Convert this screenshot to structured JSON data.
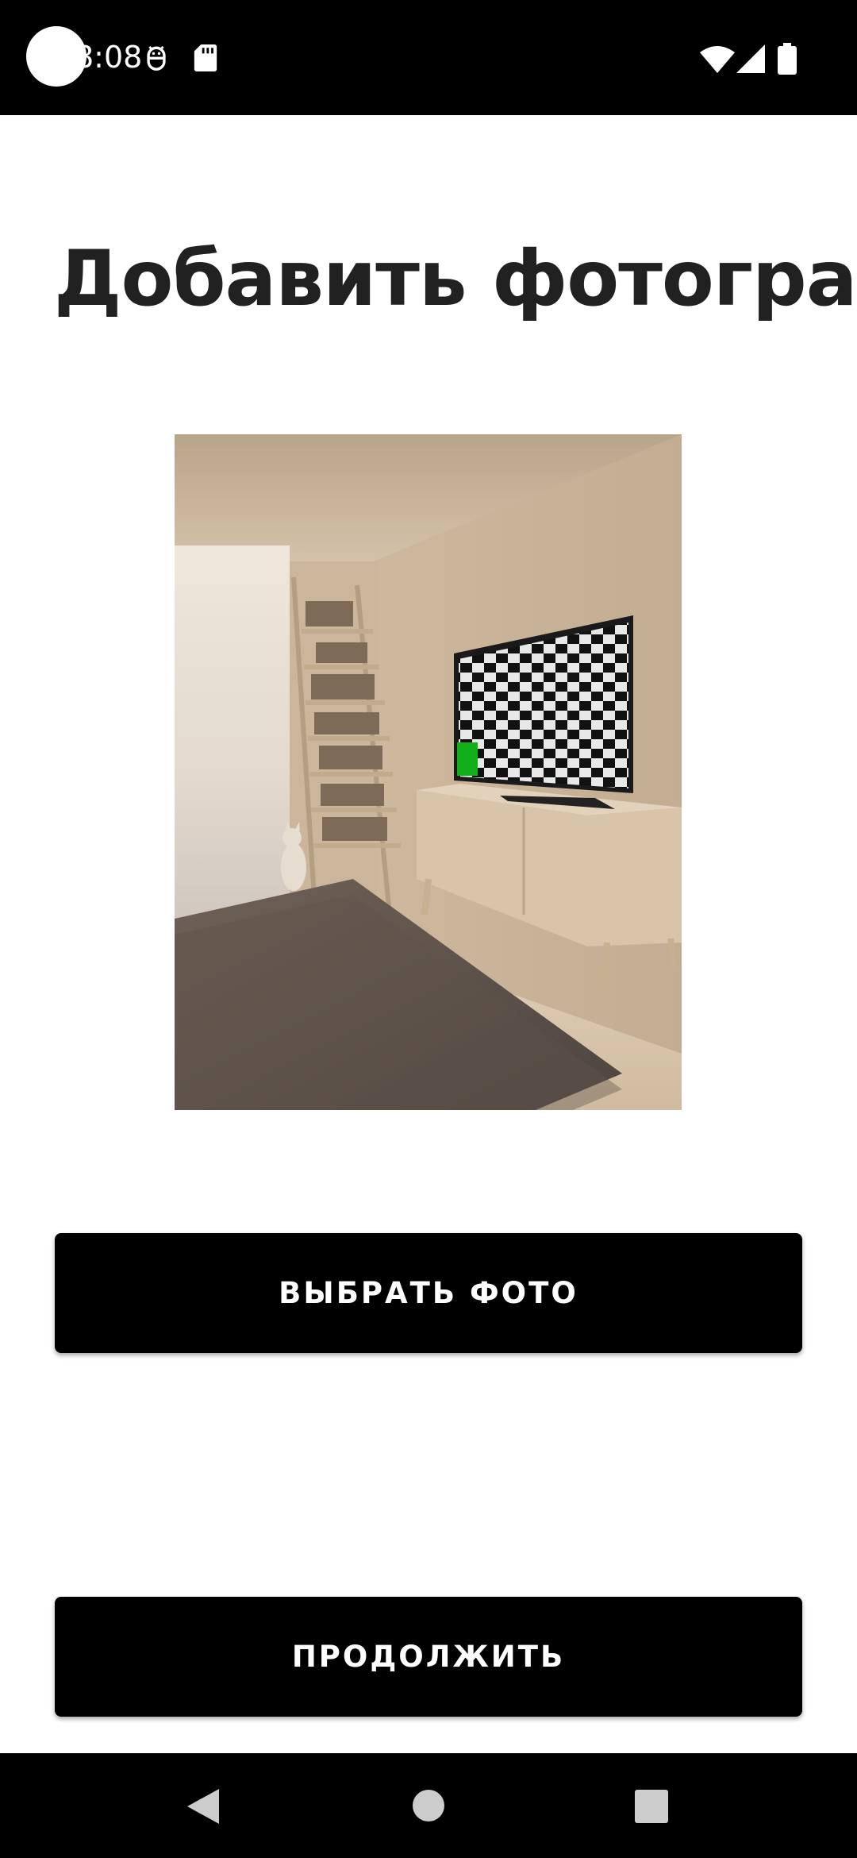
{
  "status_bar": {
    "time": "8:08",
    "icons": [
      "android-debug-icon",
      "sd-card-icon",
      "wifi-icon",
      "signal-icon",
      "battery-icon"
    ]
  },
  "page": {
    "title": "Добавить фотографии"
  },
  "photo": {
    "description_icon": "room-photo-preview"
  },
  "buttons": {
    "choose_photo": "ВЫБРАТЬ ФОТО",
    "continue": "ПРОДОЛЖИТЬ"
  },
  "nav_bar": {
    "icons": [
      "back-icon",
      "home-icon",
      "recents-icon"
    ]
  },
  "colors": {
    "button_bg": "#000000",
    "button_text": "#ffffff",
    "title_text": "#212121",
    "background": "#ffffff"
  }
}
